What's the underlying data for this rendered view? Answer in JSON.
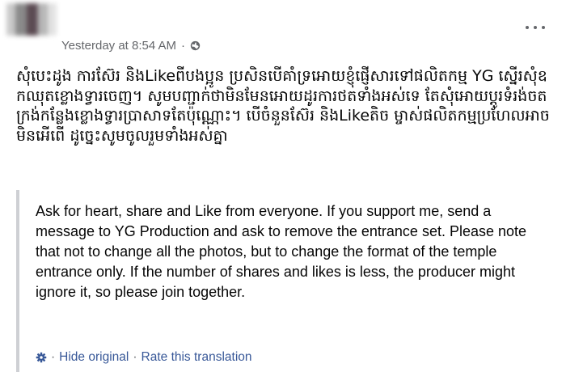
{
  "post": {
    "timestamp": "Yesterday at 8:54 AM",
    "separator": "·",
    "privacy_icon": "globe-icon",
    "more_icon": "more-options-icon",
    "original_text": "សុំបេះដូង ការស៊ែរ និងLikeពីបងប្អូន ប្រសិនបើគាំទ្រអោយខ្ញុំផ្ញើសារទៅផលិតកម្ម YG ស្នើរសុំឧកឈុតខ្លោងទ្វារចេញ។ សូមបញ្ជាក់ថាមិនមែនអោយដូរការថតទាំងអស់ទេ តែសុំអោយប្ដូរទំរង់ចតក្រង់កន្លែងខ្លោងទ្វារប្រាសាទតែប៉ុណ្ណោះ។ បើចំនួនស៊ែរ និងLikeតិច ម្ចាស់ផលិតកម្មប្រហែលអាចមិនអើពើ ដូច្នេះសូមចូលរួមទាំងអស់គ្នា"
  },
  "translation": {
    "text": "Ask for heart, share and Like from everyone. If you support me, send a message to YG Production and ask to remove the entrance set. Please note that not to change all the photos, but to change the format of the temple entrance only. If the number of shares and likes is less, the producer might ignore it, so please join together.",
    "settings_icon": "gear-icon",
    "separator": "·",
    "hide_original_label": "Hide original",
    "rate_label": "Rate this translation",
    "link_color": "#385898",
    "border_color": "#ced0d4"
  }
}
